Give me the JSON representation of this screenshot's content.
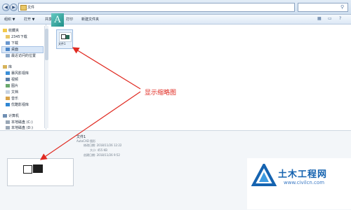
{
  "address": {
    "path": "文件"
  },
  "toolbar": {
    "organize": "组织 ▼",
    "open": "打开 ▼",
    "share": "共享 ▼",
    "print": "打印",
    "new_folder": "新建文件夹"
  },
  "sidebar": {
    "favorites": "收藏夹",
    "items1": [
      "2345下载",
      "下载",
      "桌面",
      "最近访问的位置"
    ],
    "library": "库",
    "items2": [
      "暴风影视库",
      "视频",
      "图片",
      "文档",
      "音乐",
      "优酷影视库"
    ],
    "computer": "计算机",
    "items3": [
      "本地磁盘 (C:)",
      "本地磁盘 (D:)"
    ]
  },
  "file": {
    "name": "文件1"
  },
  "callout": {
    "text": "显示缩略图"
  },
  "details": {
    "name": "文件1",
    "type": "AutoCAD 图形",
    "modified": "修改日期: 2018/11/26 12:22",
    "size": "大小: 455 KB",
    "created": "创建日期: 2018/11/26 9:52"
  },
  "watermark": {
    "title": "土木工程网",
    "url": "www.civilcn.com"
  },
  "colors": {
    "callout": "#e02a21",
    "brand": "#1563b0"
  }
}
